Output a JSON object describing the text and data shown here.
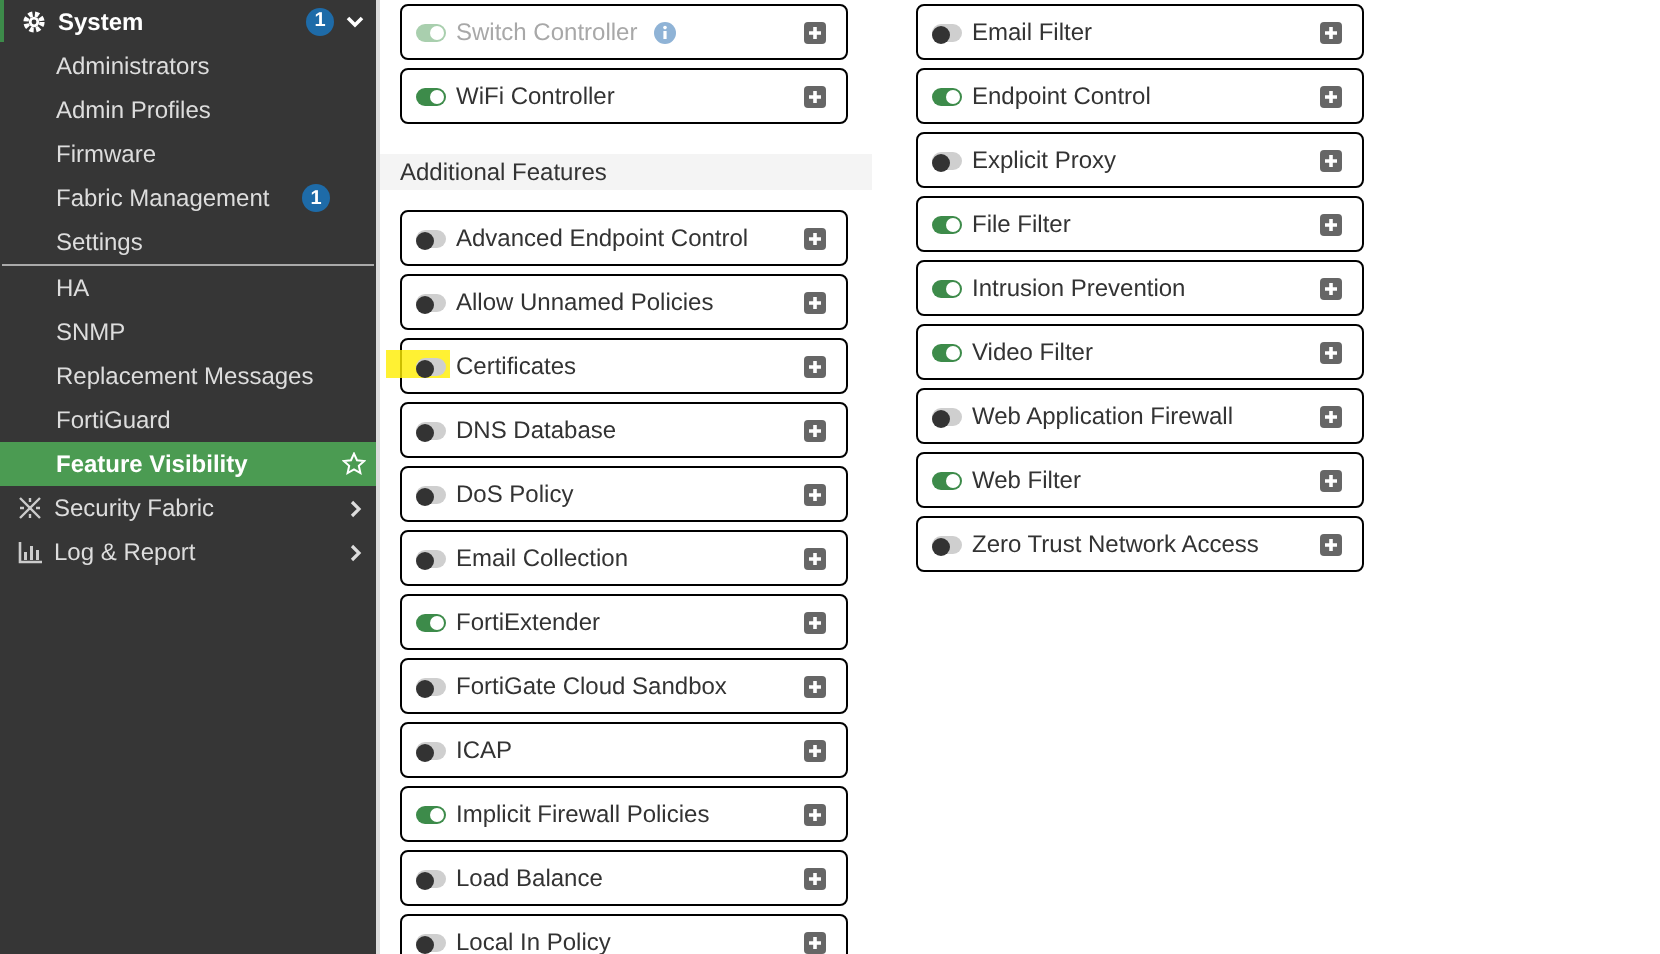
{
  "sidebar": {
    "section": {
      "label": "System",
      "badge": "1",
      "expanded": true
    },
    "items": [
      {
        "label": "Administrators",
        "selected": false
      },
      {
        "label": "Admin Profiles",
        "selected": false
      },
      {
        "label": "Firmware",
        "selected": false
      },
      {
        "label": "Fabric Management",
        "selected": false,
        "badge": "1"
      },
      {
        "label": "Settings",
        "selected": false,
        "divider_after": true
      },
      {
        "label": "HA",
        "selected": false
      },
      {
        "label": "SNMP",
        "selected": false
      },
      {
        "label": "Replacement Messages",
        "selected": false
      },
      {
        "label": "FortiGuard",
        "selected": false
      },
      {
        "label": "Feature Visibility",
        "selected": true
      }
    ],
    "sections": [
      {
        "label": "Security Fabric",
        "kind": "fabric"
      },
      {
        "label": "Log & Report",
        "kind": "report"
      }
    ]
  },
  "left_features": [
    {
      "label": "Switch Controller",
      "on": true,
      "disabled": true,
      "info": true
    },
    {
      "label": "WiFi Controller",
      "on": true,
      "disabled": false
    }
  ],
  "additional_header": "Additional Features",
  "additional_features": [
    {
      "label": "Advanced Endpoint Control",
      "on": false
    },
    {
      "label": "Allow Unnamed Policies",
      "on": false
    },
    {
      "label": "Certificates",
      "on": false,
      "highlighted": true
    },
    {
      "label": "DNS Database",
      "on": false
    },
    {
      "label": "DoS Policy",
      "on": false
    },
    {
      "label": "Email Collection",
      "on": false
    },
    {
      "label": "FortiExtender",
      "on": true
    },
    {
      "label": "FortiGate Cloud Sandbox",
      "on": false
    },
    {
      "label": "ICAP",
      "on": false
    },
    {
      "label": "Implicit Firewall Policies",
      "on": true
    },
    {
      "label": "Load Balance",
      "on": false
    },
    {
      "label": "Local In Policy",
      "on": false
    }
  ],
  "right_features": [
    {
      "label": "Email Filter",
      "on": false
    },
    {
      "label": "Endpoint Control",
      "on": true
    },
    {
      "label": "Explicit Proxy",
      "on": false
    },
    {
      "label": "File Filter",
      "on": true
    },
    {
      "label": "Intrusion Prevention",
      "on": true
    },
    {
      "label": "Video Filter",
      "on": true
    },
    {
      "label": "Web Application Firewall",
      "on": false
    },
    {
      "label": "Web Filter",
      "on": true
    },
    {
      "label": "Zero Trust Network Access",
      "on": false
    }
  ]
}
